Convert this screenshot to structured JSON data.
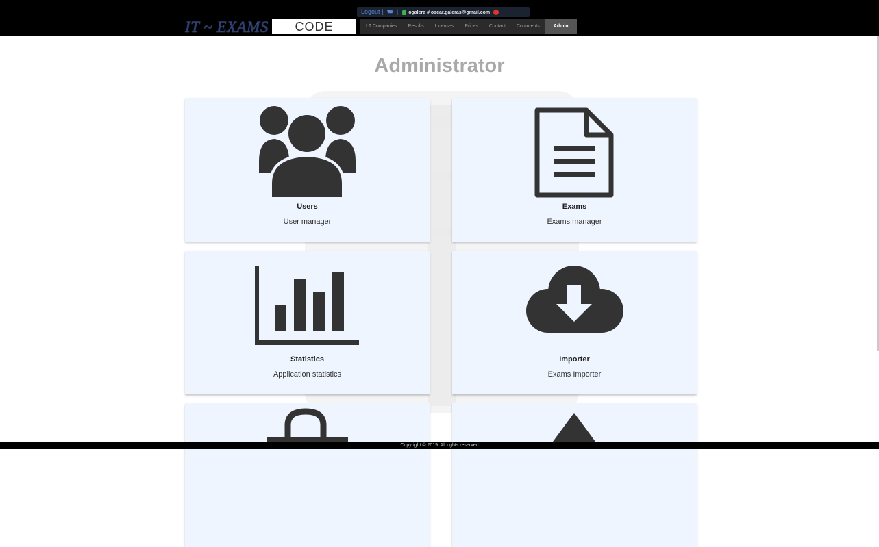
{
  "header": {
    "logout_label": "Logout",
    "username": "ogalera # oscar.galeras@gmail.com",
    "logo_text": "IT ~ EXAMS",
    "code_label": "CODE",
    "nav": [
      {
        "label": "I.T Companies"
      },
      {
        "label": "Results"
      },
      {
        "label": "Licenses"
      },
      {
        "label": "Prices"
      },
      {
        "label": "Contact"
      },
      {
        "label": "Comments"
      },
      {
        "label": "Admin",
        "active": true
      }
    ]
  },
  "main": {
    "title": "Administrator",
    "cards": [
      {
        "title": "Users",
        "subtitle": "User manager",
        "icon": "users-icon"
      },
      {
        "title": "Exams",
        "subtitle": "Exams manager",
        "icon": "document-icon"
      },
      {
        "title": "Statistics",
        "subtitle": "Application statistics",
        "icon": "bar-chart-icon"
      },
      {
        "title": "Importer",
        "subtitle": "Exams Importer",
        "icon": "cloud-download-icon"
      },
      {
        "title": "",
        "subtitle": "",
        "icon": "lock-icon"
      },
      {
        "title": "",
        "subtitle": "",
        "icon": "warning-icon"
      }
    ]
  },
  "footer": {
    "copyright": "Copyright © 2019. All rights reserved"
  },
  "colors": {
    "topbar": "#000000",
    "card_bg": "#eff5fe",
    "icon": "#333333",
    "title_gray": "#a9a9a9",
    "logout_blue": "#5a86d6"
  }
}
